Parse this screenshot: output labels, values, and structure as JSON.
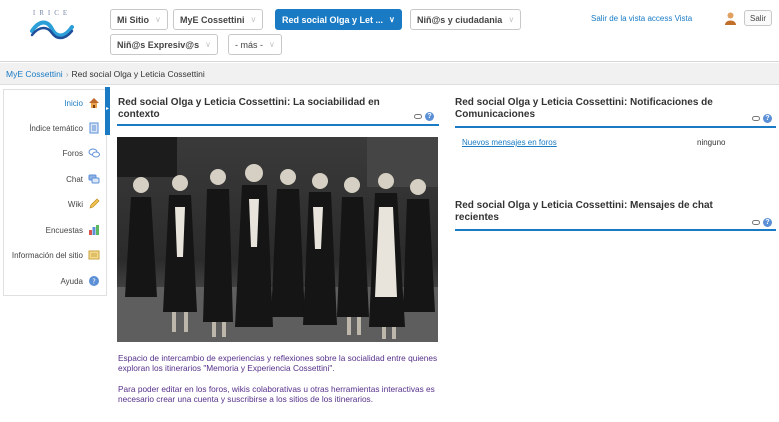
{
  "logo": {
    "text": "IRICE"
  },
  "nav": {
    "tabs": [
      {
        "label": "Mi Sitio",
        "active": false
      },
      {
        "label": "MyE Cossettini",
        "active": false
      },
      {
        "label": "Red social Olga y Let ...",
        "active": true
      },
      {
        "label": "Niñ@s y ciudadania",
        "active": false
      },
      {
        "label": "Niñ@s Expresiv@s",
        "active": false
      },
      {
        "label": "- más -",
        "active": false
      }
    ],
    "exit_view": "Salir de la vista access Vista",
    "logout": "Salir"
  },
  "breadcrumb": {
    "items": [
      "MyE Cossettini",
      "Red social Olga y Leticia Cossettini"
    ],
    "separator": "›"
  },
  "sidebar": {
    "items": [
      {
        "label": "Inicio",
        "icon": "home-icon",
        "active": true
      },
      {
        "label": "Índice temático",
        "icon": "document-icon",
        "active": false
      },
      {
        "label": "Foros",
        "icon": "speech-bubbles-icon",
        "active": false
      },
      {
        "label": "Chat",
        "icon": "chat-icon",
        "active": false
      },
      {
        "label": "Wiki",
        "icon": "pencil-icon",
        "active": false
      },
      {
        "label": "Encuestas",
        "icon": "bar-chart-icon",
        "active": false
      },
      {
        "label": "Información del sitio",
        "icon": "info-icon",
        "active": false
      },
      {
        "label": "Ayuda",
        "icon": "help-icon",
        "active": false
      }
    ]
  },
  "portlets": {
    "main": {
      "title": "Red social Olga y Leticia Cossettini: La sociabilidad en contexto",
      "paragraph1": "Espacio de intercambio de experiencias y reflexiones sobre la socialidad entre quienes exploran los itinerarios \"Memoria y Experiencia Cossettini\".",
      "paragraph2": "Para poder editar en los foros, wikis colaborativas u otras herramientas interactivas es necesario crear una cuenta y suscribirse a los sitios de los itinerarios."
    },
    "notifications": {
      "title": "Red social Olga y Leticia Cossettini: Notificaciones de Comunicaciones",
      "row_label": "Nuevos mensajes en foros",
      "row_value": "ninguno"
    },
    "chat": {
      "title": "Red social Olga y Leticia Cossettini: Mensajes de chat recientes"
    }
  },
  "colors": {
    "accent": "#1a7bc4",
    "description_text": "#55308a"
  }
}
